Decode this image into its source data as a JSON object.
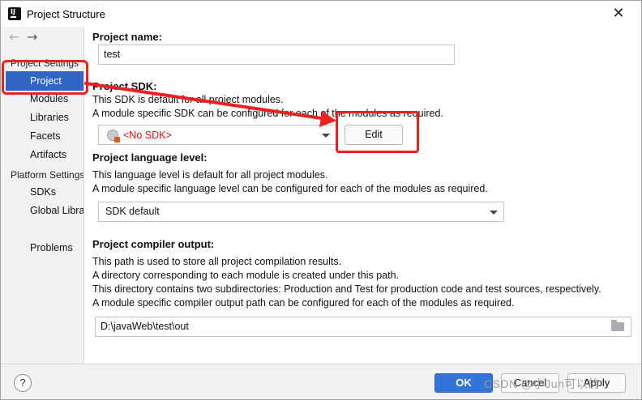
{
  "window": {
    "title": "Project Structure",
    "close_glyph": "✕"
  },
  "sidebar": {
    "back_glyph": "←",
    "forward_glyph": "→",
    "section_project_settings": "Project Settings",
    "project_settings_items": [
      {
        "label": "Project",
        "selected": true
      },
      {
        "label": "Modules"
      },
      {
        "label": "Libraries"
      },
      {
        "label": "Facets"
      },
      {
        "label": "Artifacts"
      }
    ],
    "section_platform_settings": "Platform Settings",
    "platform_settings_items": [
      {
        "label": "SDKs"
      },
      {
        "label": "Global Libraries"
      }
    ],
    "problems_label": "Problems"
  },
  "main": {
    "project_name": {
      "label": "Project name:",
      "value": "test"
    },
    "project_sdk": {
      "label": "Project SDK:",
      "desc1": "This SDK is default for all project modules.",
      "desc2": "A module specific SDK can be configured for each of the modules as required.",
      "selected": "<No SDK>",
      "edit_button": "Edit"
    },
    "language_level": {
      "label": "Project language level:",
      "desc1": "This language level is default for all project modules.",
      "desc2": "A module specific language level can be configured for each of the modules as required.",
      "selected": "SDK default"
    },
    "compiler_output": {
      "label": "Project compiler output:",
      "desc1": "This path is used to store all project compilation results.",
      "desc2": "A directory corresponding to each module is created under this path.",
      "desc3": "This directory contains two subdirectories: Production and Test for production code and test sources, respectively.",
      "desc4": "A module specific compiler output path can be configured for each of the modules as required.",
      "value": "D:\\javaWeb\\test\\out"
    }
  },
  "footer": {
    "help_glyph": "?",
    "ok_label": "OK",
    "cancel_label": "Cancel",
    "apply_label": "Apply",
    "watermark": "CSDN @小Jun可以的"
  },
  "colors": {
    "selection": "#2f66c7",
    "annotation_red": "#ee2020",
    "primary_button": "#3574d8",
    "no_sdk_text": "#e01010"
  },
  "icons": {
    "app": "intellij-icon",
    "sdk": "globe-sdk-icon",
    "folder": "folder-icon"
  }
}
